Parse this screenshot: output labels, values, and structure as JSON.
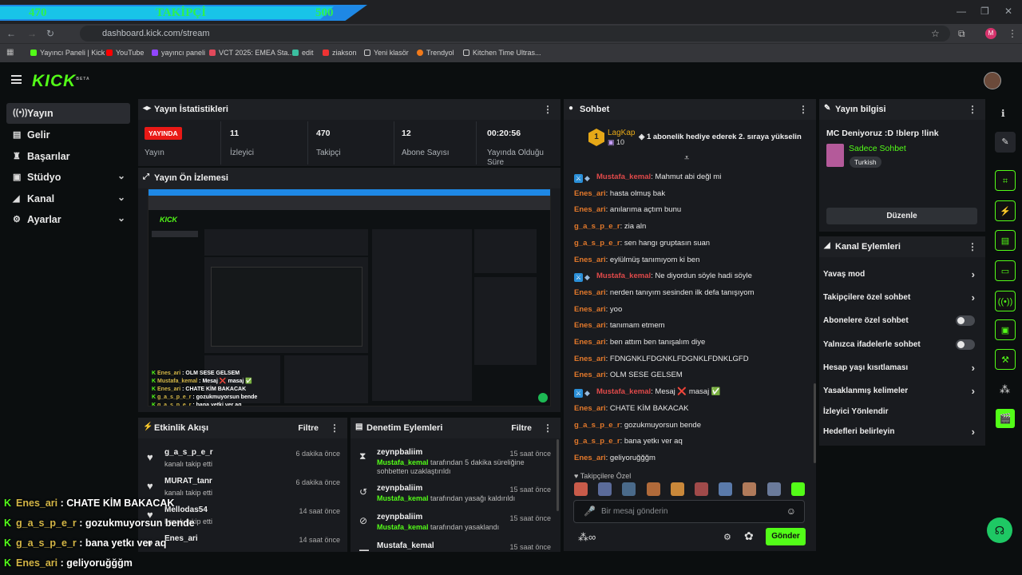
{
  "goal": {
    "current": "470",
    "label": "TAKİPÇİ",
    "target": "500"
  },
  "browser": {
    "url": "dashboard.kick.com/stream",
    "avatar_letter": "M",
    "bookmarks": [
      "Yayıncı Paneli | Kick",
      "YouTube",
      "yayıncı paneli",
      "VCT 2025: EMEA Sta...",
      "edit",
      "ziakson",
      "Yeni klasör",
      "Trendyol",
      "Kitchen Time Ultras..."
    ]
  },
  "sidebar": {
    "logo": "KICK",
    "logo_sup": "BETA",
    "items": [
      {
        "label": "Yayın",
        "icon": "broadcast-icon"
      },
      {
        "label": "Gelir",
        "icon": "money-icon"
      },
      {
        "label": "Başarılar",
        "icon": "trophy-icon"
      },
      {
        "label": "Stüdyo",
        "icon": "studio-icon"
      },
      {
        "label": "Kanal",
        "icon": "channel-icon"
      },
      {
        "label": "Ayarlar",
        "icon": "gear-icon"
      }
    ]
  },
  "stats": {
    "title": "Yayın İstatistikleri",
    "live_badge": "YAYINDA",
    "live_label": "Yayın",
    "items": [
      {
        "value": "11",
        "label": "İzleyici"
      },
      {
        "value": "470",
        "label": "Takipçi"
      },
      {
        "value": "12",
        "label": "Abone Sayısı"
      },
      {
        "value": "00:20:56",
        "label": "Yayında Olduğu Süre"
      }
    ]
  },
  "preview": {
    "title": "Yayın Ön İzlemesi"
  },
  "activity": {
    "title": "Etkinlik Akışı",
    "filter": "Filtre",
    "rows": [
      {
        "name": "g_a_s_p_e_r",
        "sub": "kanalı takip etti",
        "time": "6 dakika önce"
      },
      {
        "name": "MURAT_tanr",
        "sub": "kanalı takip etti",
        "time": "6 dakika önce"
      },
      {
        "name": "Mellodas54",
        "sub": "kanalı takip etti",
        "time": "14 saat önce"
      },
      {
        "name": "Enes_ari",
        "sub": "",
        "time": "14 saat önce"
      }
    ]
  },
  "moderation": {
    "title": "Denetim Eylemleri",
    "filter": "Filtre",
    "rows": [
      {
        "name": "zeynpbaliim",
        "mod": "Mustafa_kemal",
        "text": "tarafından 5 dakika süreliğine sohbetten uzaklaştırıldı",
        "time": "15 saat önce"
      },
      {
        "name": "zeynpbaliim",
        "mod": "Mustafa_kemal",
        "text": "tarafından yasağı kaldırıldı",
        "time": "15 saat önce"
      },
      {
        "name": "zeynpbaliim",
        "mod": "Mustafa_kemal",
        "text": "tarafından yasaklandı",
        "time": "15 saat önce"
      },
      {
        "name": "Mustafa_kemal",
        "mod": "",
        "text": "",
        "time": "15 saat önce"
      }
    ]
  },
  "chat": {
    "title": "Sohbet",
    "pinned_user": "LagKap",
    "pinned_level": "10",
    "pinned_text": "1 abonelik hediye ederek 2. sıraya yükselin",
    "messages": [
      {
        "user": "Mustafa_kemal",
        "text": "Mahmut abi değl mi",
        "color": "#e14a4a",
        "badges": true
      },
      {
        "user": "Enes_ari",
        "text": "hasta olmuş bak",
        "color": "#e3792b"
      },
      {
        "user": "Enes_ari",
        "text": "anılarıma açtım bunu",
        "color": "#e3792b"
      },
      {
        "user": "g_a_s_p_e_r",
        "text": "zia aln",
        "color": "#e3792b"
      },
      {
        "user": "g_a_s_p_e_r",
        "text": "sen hangı gruptasın suan",
        "color": "#e3792b"
      },
      {
        "user": "Enes_ari",
        "text": "eylülmüş tanımıyom ki ben",
        "color": "#e3792b"
      },
      {
        "user": "Mustafa_kemal",
        "text": "Ne diyordun söyle hadi söyle",
        "color": "#e14a4a",
        "badges": true
      },
      {
        "user": "Enes_ari",
        "text": "nerden tanıyım sesinden ilk defa tanışıyom",
        "color": "#e3792b"
      },
      {
        "user": "Enes_ari",
        "text": "yoo",
        "color": "#e3792b"
      },
      {
        "user": "Enes_ari",
        "text": "tanımam etmem",
        "color": "#e3792b"
      },
      {
        "user": "Enes_ari",
        "text": "ben attım ben tanışalım diye",
        "color": "#e3792b"
      },
      {
        "user": "Enes_ari",
        "text": "FDNGNKLFDGNKLFDGNKLFDNKLGFD",
        "color": "#e3792b"
      },
      {
        "user": "Enes_ari",
        "text": "OLM SESE GELSEM",
        "color": "#e3792b"
      },
      {
        "user": "Mustafa_kemal",
        "text": "Mesaj ❌ masaj ✅",
        "color": "#e14a4a",
        "badges": true
      },
      {
        "user": "Enes_ari",
        "text": "CHATE KİM BAKACAK",
        "color": "#e3792b"
      },
      {
        "user": "g_a_s_p_e_r",
        "text": "gozukmuyorsun bende",
        "color": "#e3792b"
      },
      {
        "user": "g_a_s_p_e_r",
        "text": "bana yetkı ver aq",
        "color": "#e3792b"
      },
      {
        "user": "Enes_ari",
        "text": "geliyoruğğğm",
        "color": "#e3792b"
      }
    ],
    "followers_only": "Takipçilere Özel",
    "placeholder": "Bir mesaj gönderin",
    "send": "Gönder"
  },
  "stream_info": {
    "title": "Yayın bilgisi",
    "stream_title": "MC Deniyoruz :D !blerp !link",
    "category": "Sadece Sohbet",
    "tag": "Turkish",
    "edit": "Düzenle"
  },
  "channel_actions": {
    "title": "Kanal Eylemleri",
    "items": [
      {
        "label": "Yavaş mod",
        "kind": "chevron"
      },
      {
        "label": "Takipçilere özel sohbet",
        "kind": "chevron"
      },
      {
        "label": "Abonelere özel sohbet",
        "kind": "toggle",
        "on": false
      },
      {
        "label": "Yalnızca ifadelerle sohbet",
        "kind": "toggle",
        "on": false
      },
      {
        "label": "Hesap yaşı kısıtlaması",
        "kind": "chevron"
      },
      {
        "label": "Yasaklanmış kelimeler",
        "kind": "chevron"
      },
      {
        "label": "İzleyici Yönlendir",
        "kind": "none"
      },
      {
        "label": "Hedefleri belirleyin",
        "kind": "chevron"
      }
    ]
  },
  "overlay_chat": [
    {
      "user": "Enes_ari",
      "text": "CHATE KİM BAKACAK"
    },
    {
      "user": "g_a_s_p_e_r",
      "text": "gozukmuyorsun bende"
    },
    {
      "user": "g_a_s_p_e_r",
      "text": "bana yetkı ver aq"
    },
    {
      "user": "Enes_ari",
      "text": "geliyoruğğğm"
    }
  ],
  "colors": {
    "accent": "#53fc18",
    "live": "#e91916",
    "panel": "#191b1f"
  }
}
